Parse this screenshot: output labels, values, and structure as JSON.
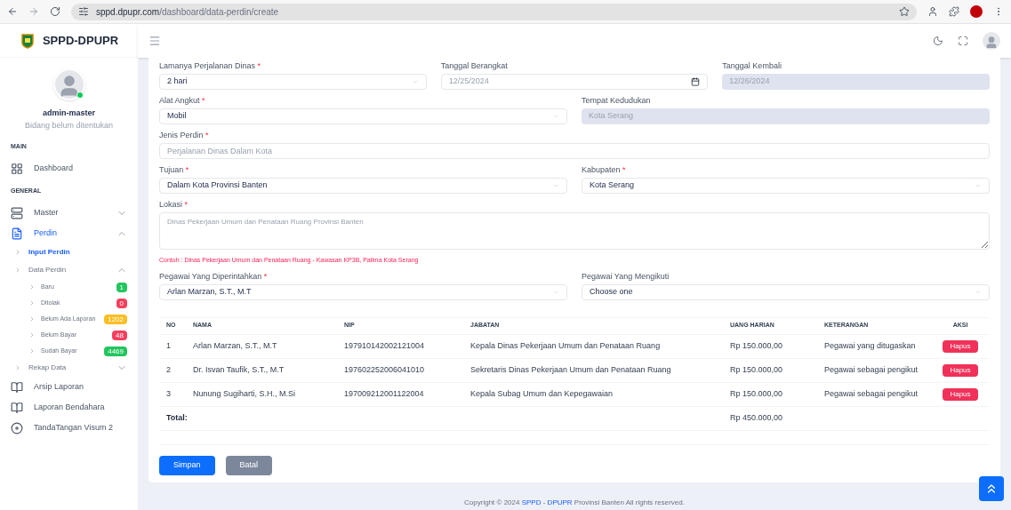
{
  "browser": {
    "url_host": "sppd.dpupr.com",
    "url_path": "/dashboard/data-perdin/create"
  },
  "app": {
    "title": "SPPD-DPUPR"
  },
  "user": {
    "name": "admin-master",
    "role": "Bidang belum ditentukan",
    "online": true
  },
  "sidebar": [
    {
      "kind": "section",
      "label": "MAIN"
    },
    {
      "kind": "item",
      "label": "Dashboard",
      "selected": false
    },
    {
      "kind": "section",
      "label": "GENERAL"
    },
    {
      "kind": "item",
      "label": "Master",
      "selected": false,
      "expanded": false
    },
    {
      "kind": "item",
      "label": "Perdin",
      "selected": true,
      "expanded": true,
      "children": [
        {
          "label": "Input Perdin",
          "selected": true
        },
        {
          "label": "Data Perdin",
          "selected": false,
          "expanded": true,
          "children": [
            {
              "label": "Baru",
              "badge": "1",
              "color": "#22c55e"
            },
            {
              "label": "Ditolak",
              "badge": "0",
              "color": "#f43f5e"
            },
            {
              "label": "Belum Ada Laporan",
              "badge": "1202",
              "color": "#fbbf24"
            },
            {
              "label": "Belum Bayar",
              "badge": "48",
              "color": "#f43f5e"
            },
            {
              "label": "Sudah Bayar",
              "badge": "4469",
              "color": "#22c55e"
            }
          ]
        },
        {
          "label": "Rekap Data",
          "selected": false,
          "expanded": false
        }
      ]
    },
    {
      "kind": "item",
      "label": "Arsip Laporan",
      "selected": false
    },
    {
      "kind": "item",
      "label": "Laporan Bendahara",
      "selected": false
    },
    {
      "kind": "item",
      "label": "TandaTangan Visum 2",
      "selected": false
    }
  ],
  "form_rows": [
    [
      {
        "label": "Lamanya Perjalanan Dinas",
        "required_mark": "*",
        "kind": "select",
        "value": "2 hari"
      },
      {
        "label": "Tanggal Berangkat",
        "kind": "date",
        "value": "12/25/2024"
      },
      {
        "label": "Tanggal Kembali",
        "kind": "readonly",
        "value": "12/26/2024"
      }
    ],
    [
      {
        "label": "Alat Angkut",
        "required_mark": "*",
        "kind": "select",
        "value": "Mobil"
      },
      {
        "label": "Tempat Kedudukan",
        "kind": "readonly",
        "value": "Kota Serang"
      }
    ],
    [
      {
        "label": "Jenis Perdin",
        "required_mark": "*",
        "kind": "text",
        "placeholder": "Perjalanan Dinas Dalam Kota"
      }
    ],
    [
      {
        "label": "Tujuan",
        "required_mark": "*",
        "kind": "select",
        "value": "Dalam Kota Provinsi Banten"
      },
      {
        "label": "Kabupaten",
        "required_mark": "*",
        "kind": "select",
        "value": "Kota Serang"
      }
    ],
    [
      {
        "label": "Lokasi",
        "required_mark": "*",
        "kind": "textarea",
        "placeholder": "Dinas Pekerjaan Umum dan Penataan Ruang Provinsi Banten",
        "hint": "Contoh : Dinas Pekerjaan Umum dan Penataan Ruang - Kawasan KP3B, Palima Kota Serang"
      }
    ],
    [
      {
        "label": "Pegawai Yang Diperintahkan",
        "required_mark": "*",
        "kind": "select",
        "value": "Arlan Marzan, S.T., M.T"
      },
      {
        "label": "Pegawai Yang Mengikuti",
        "kind": "select",
        "value": "Choose one"
      }
    ]
  ],
  "table": {
    "columns": [
      "NO",
      "NAMA",
      "NIP",
      "JABATAN",
      "UANG HARIAN",
      "KETERANGAN",
      "AKSI"
    ],
    "rows": [
      {
        "no": "1",
        "nama": "Arlan Marzan, S.T., M.T",
        "nip": "197910142002121004",
        "jabatan": "Kepala Dinas Pekerjaan Umum dan Penataan Ruang",
        "uang": "Rp 150.000,00",
        "keterangan": "Pegawai yang ditugaskan",
        "action": "Hapus"
      },
      {
        "no": "2",
        "nama": "Dr. Isvan Taufik, S.T., M.T",
        "nip": "197602252006041010",
        "jabatan": "Sekretaris Dinas Pekerjaan Umum dan Penataan Ruang",
        "uang": "Rp 150.000,00",
        "keterangan": "Pegawai sebagai pengikut",
        "action": "Hapus"
      },
      {
        "no": "3",
        "nama": "Nunung Sugiharti, S.H., M.Si",
        "nip": "197009212001122004",
        "jabatan": "Kepala Subag Umum dan Kepegawaian",
        "uang": "Rp 150.000,00",
        "keterangan": "Pegawai sebagai pengikut",
        "action": "Hapus"
      }
    ],
    "total_label": "Total:",
    "total": "Rp 450.000,00"
  },
  "buttons": {
    "save": "Simpan",
    "cancel": "Batal"
  },
  "footer": {
    "prefix": "Copyright © 2024",
    "link1": "SPPD",
    "sep": "-",
    "link2": "DPUPR",
    "suffix": "Provinsi Banten All rights reserved."
  }
}
